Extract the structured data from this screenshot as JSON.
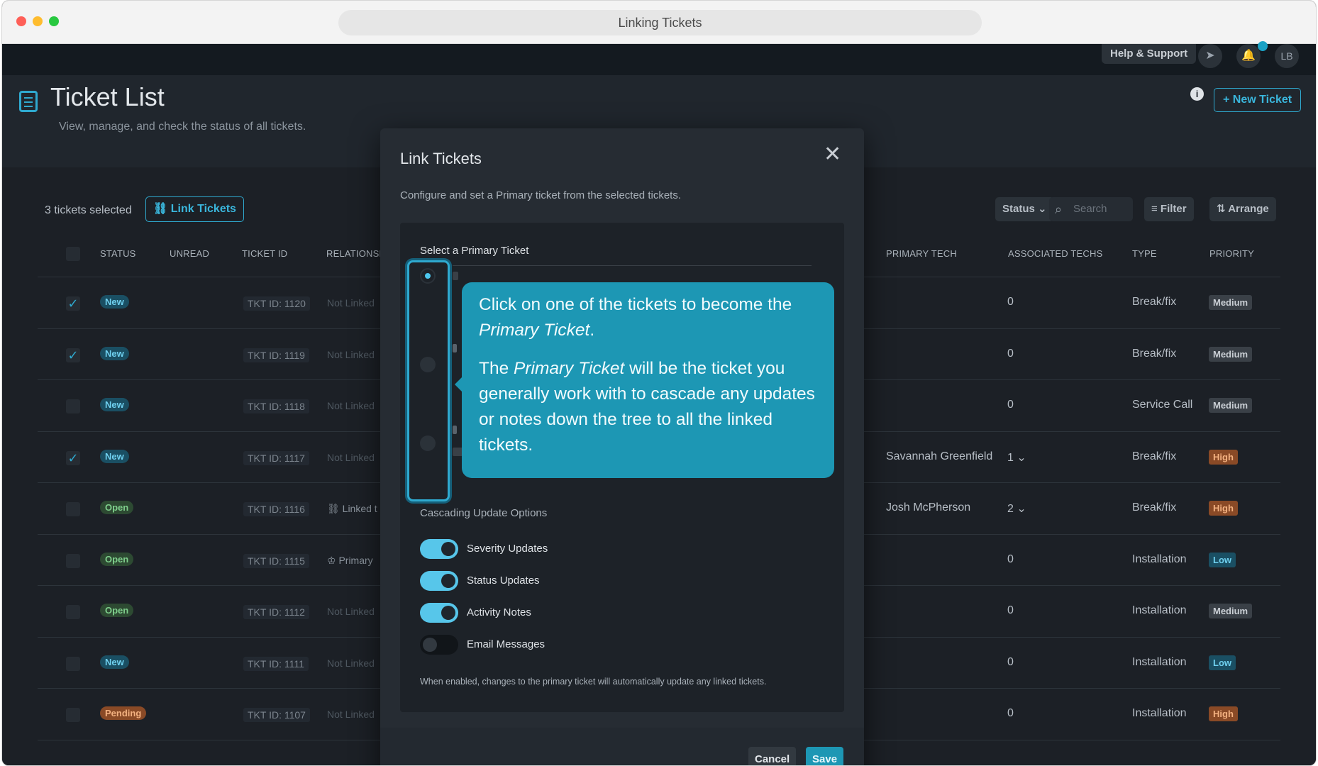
{
  "window": {
    "title": "Linking Tickets"
  },
  "topnav": {
    "help": "Help & Support",
    "avatar": "LB"
  },
  "header": {
    "title": "Ticket List",
    "subtitle": "View, manage, and check the status of all tickets.",
    "new_ticket": "+ New Ticket",
    "info": "i"
  },
  "toolbar": {
    "selected": "3 tickets selected",
    "link_tickets": "Link Tickets",
    "status": "Status",
    "search_placeholder": "Search",
    "filter": "Filter",
    "arrange": "Arrange"
  },
  "table": {
    "columns": [
      "STATUS",
      "UNREAD",
      "TICKET ID",
      "RELATIONSH",
      "PRIMARY TECH",
      "ASSOCIATED TECHS",
      "TYPE",
      "PRIORITY"
    ],
    "rows": [
      {
        "checked": "✓",
        "status": "New",
        "status_kind": "new",
        "id": "TKT ID: 1120",
        "relationship": "Not Linked",
        "primary_tech": "",
        "assoc": "0",
        "type": "Break/fix",
        "priority": "Medium",
        "priority_kind": "medium"
      },
      {
        "checked": "✓",
        "status": "New",
        "status_kind": "new",
        "id": "TKT ID: 1119",
        "relationship": "Not Linked",
        "primary_tech": "",
        "assoc": "0",
        "type": "Break/fix",
        "priority": "Medium",
        "priority_kind": "medium"
      },
      {
        "checked": "",
        "status": "New",
        "status_kind": "new",
        "id": "TKT ID: 1118",
        "relationship": "Not Linked",
        "primary_tech": "",
        "assoc": "0",
        "type": "Service Call",
        "priority": "Medium",
        "priority_kind": "medium"
      },
      {
        "checked": "✓",
        "status": "New",
        "status_kind": "new",
        "id": "TKT ID: 1117",
        "relationship": "Not Linked",
        "primary_tech": "Savannah Greenfield",
        "assoc": "1 ⌄",
        "type": "Break/fix",
        "priority": "High",
        "priority_kind": "high"
      },
      {
        "checked": "",
        "status": "Open",
        "status_kind": "open",
        "id": "TKT ID: 1116",
        "relationship": "⛓ Linked t",
        "primary_tech": "Josh McPherson",
        "assoc": "2 ⌄",
        "type": "Break/fix",
        "priority": "High",
        "priority_kind": "high"
      },
      {
        "checked": "",
        "status": "Open",
        "status_kind": "open",
        "id": "TKT ID: 1115",
        "relationship": "♔ Primary",
        "primary_tech": "",
        "assoc": "0",
        "type": "Installation",
        "priority": "Low",
        "priority_kind": "low"
      },
      {
        "checked": "",
        "status": "Open",
        "status_kind": "open",
        "id": "TKT ID: 1112",
        "relationship": "Not Linked",
        "primary_tech": "",
        "assoc": "0",
        "type": "Installation",
        "priority": "Medium",
        "priority_kind": "medium"
      },
      {
        "checked": "",
        "status": "New",
        "status_kind": "new",
        "id": "TKT ID: 1111",
        "relationship": "Not Linked",
        "primary_tech": "",
        "assoc": "0",
        "type": "Installation",
        "priority": "Low",
        "priority_kind": "low"
      },
      {
        "checked": "",
        "status": "Pending",
        "status_kind": "pending",
        "id": "TKT ID: 1107",
        "relationship": "Not Linked",
        "primary_tech": "",
        "assoc": "0",
        "type": "Installation",
        "priority": "High",
        "priority_kind": "high"
      }
    ]
  },
  "modal": {
    "title": "Link Tickets",
    "close": "✕",
    "description": "Configure and set a Primary ticket from the selected tickets.",
    "select_label": "Select a Primary Ticket",
    "tooltip": {
      "p1_a": "Click on one of the tickets to become the ",
      "p1_em": "Primary Ticket",
      "p1_b": ".",
      "p2_a": "The ",
      "p2_em": "Primary Ticket",
      "p2_b": " will be the ticket you generally work with to cascade any updates or notes down the tree to all the linked tickets."
    },
    "cascade_label": "Cascading Update Options",
    "toggles": [
      {
        "label": "Severity Updates",
        "on": true
      },
      {
        "label": "Status Updates",
        "on": true
      },
      {
        "label": "Activity Notes",
        "on": true
      },
      {
        "label": "Email Messages",
        "on": false
      }
    ],
    "note": "When enabled, changes to the primary ticket will automatically update any linked tickets.",
    "cancel": "Cancel",
    "save": "Save"
  }
}
